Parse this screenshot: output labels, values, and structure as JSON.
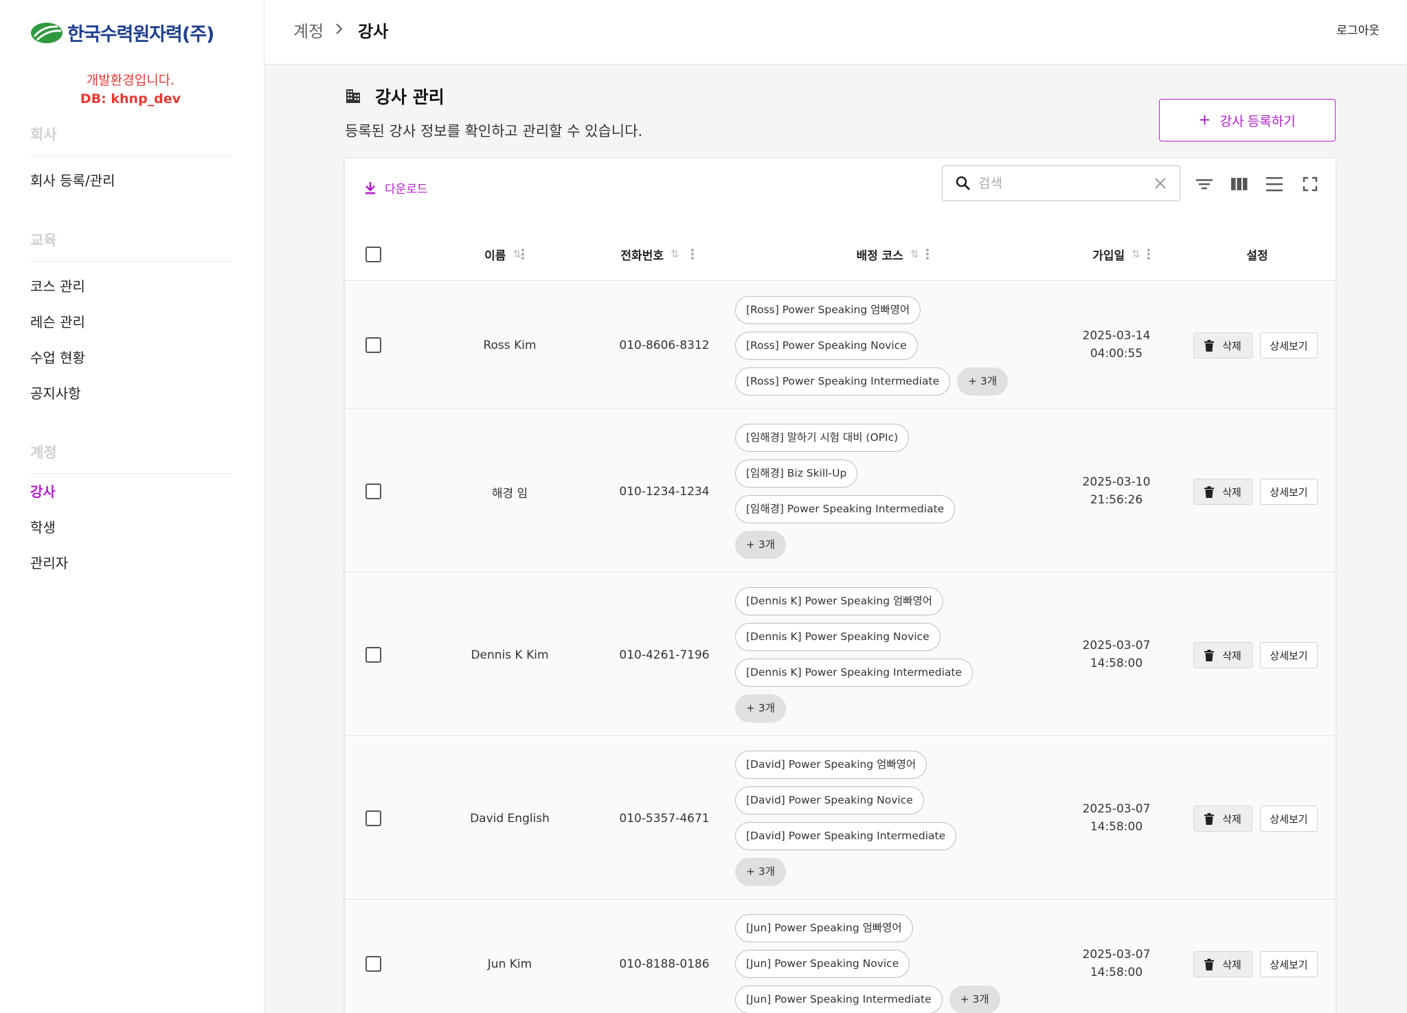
{
  "brand": {
    "logo_text": "한국수력원자력(주)",
    "green": "#2e9a3e",
    "blue": "#1f3f8f"
  },
  "env": {
    "line1": "개발환경입니다.",
    "line2": "DB: khnp_dev"
  },
  "sidebar": {
    "sections": [
      {
        "heading": "회사",
        "items": [
          "회사 등록/관리"
        ]
      },
      {
        "heading": "교육",
        "items": [
          "코스 관리",
          "레슨 관리",
          "수업 현황",
          "공지사항"
        ]
      },
      {
        "heading": "계정",
        "items": [
          "강사",
          "학생",
          "관리자"
        ]
      }
    ],
    "active_item": "강사"
  },
  "topbar": {
    "breadcrumb_parent": "계정",
    "breadcrumb_separator": "›",
    "breadcrumb_current": "강사",
    "logout_label": "로그아웃"
  },
  "page": {
    "title": "강사 관리",
    "title_icon": "building-icon",
    "description": "등록된 강사 정보를 확인하고 관리할 수 있습니다.",
    "add_button_label": "강사 등록하기",
    "accent_color": "#b01fc9"
  },
  "toolbar": {
    "download_label": "다운로드",
    "search_placeholder": "검색",
    "icons": [
      "filter-icon",
      "columns-icon",
      "density-icon",
      "fullscreen-icon"
    ]
  },
  "table": {
    "columns": {
      "name": "이름",
      "phone": "전화번호",
      "courses": "배정 코스",
      "joined": "가입일",
      "settings": "설정"
    },
    "delete_label": "삭제",
    "detail_label": "상세보기",
    "rows": [
      {
        "name": "Ross Kim",
        "phone": "010-8606-8312",
        "courses": [
          "[Ross] Power Speaking 엄빠영어",
          "[Ross] Power Speaking Novice",
          "[Ross] Power Speaking Intermediate"
        ],
        "more": "+ 3개",
        "date": "2025-03-14",
        "time": "04:00:55"
      },
      {
        "name": "해경 임",
        "phone": "010-1234-1234",
        "courses": [
          "[임해경] 말하기 시험 대비 (OPIc)",
          "[임해경] Biz Skill-Up",
          "[임해경] Power Speaking Intermediate"
        ],
        "more": "+ 3개",
        "date": "2025-03-10",
        "time": "21:56:26"
      },
      {
        "name": "Dennis K Kim",
        "phone": "010-4261-7196",
        "courses": [
          "[Dennis K] Power Speaking 엄빠영어",
          "[Dennis K] Power Speaking Novice",
          "[Dennis K] Power Speaking Intermediate"
        ],
        "more": "+ 3개",
        "date": "2025-03-07",
        "time": "14:58:00"
      },
      {
        "name": "David English",
        "phone": "010-5357-4671",
        "courses": [
          "[David] Power Speaking 엄빠영어",
          "[David] Power Speaking Novice",
          "[David] Power Speaking Intermediate"
        ],
        "more": "+ 3개",
        "date": "2025-03-07",
        "time": "14:58:00"
      },
      {
        "name": "Jun Kim",
        "phone": "010-8188-0186",
        "courses": [
          "[Jun] Power Speaking 엄빠영어",
          "[Jun] Power Speaking Novice",
          "[Jun] Power Speaking Intermediate"
        ],
        "more": "+ 3개",
        "date": "2025-03-07",
        "time": "14:58:00"
      }
    ]
  }
}
